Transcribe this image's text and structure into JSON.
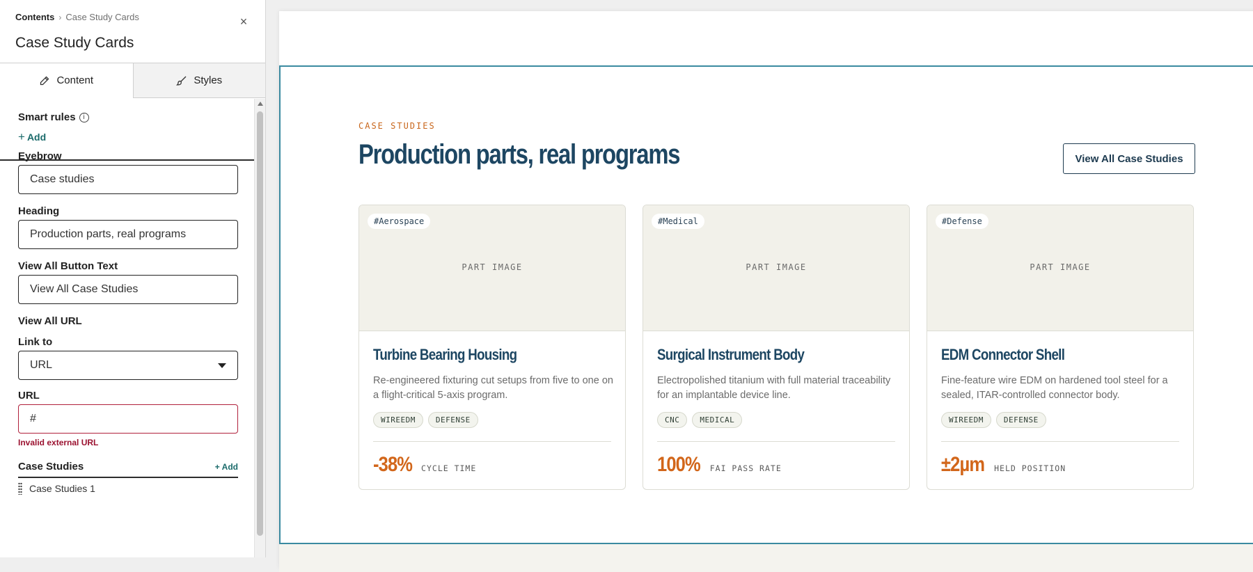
{
  "panel": {
    "breadcrumb_root": "Contents",
    "breadcrumb_sep": "›",
    "breadcrumb_current": "Case Study Cards",
    "title": "Case Study Cards",
    "close_icon": "×",
    "tabs": [
      {
        "label": "Content",
        "icon": "pencil-icon",
        "active": true
      },
      {
        "label": "Styles",
        "icon": "brush-icon",
        "active": false
      }
    ],
    "smart_rules_label": "Smart rules",
    "info_icon": "i",
    "add_plus": "+",
    "add_label": "Add",
    "fields": {
      "eyebrow_label": "Eyebrow",
      "eyebrow_value": "Case studies",
      "heading_label": "Heading",
      "heading_value": "Production parts, real programs",
      "button_text_label": "View All Button Text",
      "button_text_value": "View All Case Studies",
      "view_all_url_label": "View All URL",
      "link_to_label": "Link to",
      "link_to_value": "URL",
      "url_label": "URL",
      "url_value": "#",
      "url_error": "Invalid external URL"
    },
    "case_studies_label": "Case Studies",
    "case_studies_add": "+ Add",
    "case_studies_items": [
      "Case Studies 1"
    ]
  },
  "preview": {
    "eyebrow": "CASE STUDIES",
    "heading": "Production parts, real programs",
    "view_all_button": "View All Case Studies",
    "image_placeholder": "PART IMAGE",
    "cards": [
      {
        "tag": "#Aerospace",
        "title": "Turbine Bearing Housing",
        "description": "Re-engineered fixturing cut setups from five to one on a flight-critical 5-axis program.",
        "chips": [
          "WIREEDM",
          "DEFENSE"
        ],
        "stat_value": "-38%",
        "stat_label": "CYCLE TIME"
      },
      {
        "tag": "#Medical",
        "title": "Surgical Instrument Body",
        "description": "Electropolished titanium with full material traceability for an implantable device line.",
        "chips": [
          "CNC",
          "MEDICAL"
        ],
        "stat_value": "100%",
        "stat_label": "FAI PASS RATE"
      },
      {
        "tag": "#Defense",
        "title": "EDM Connector Shell",
        "description": "Fine-feature wire EDM on hardened tool steel for a sealed, ITAR-controlled connector body.",
        "chips": [
          "WIREEDM",
          "DEFENSE"
        ],
        "stat_value": "±2µm",
        "stat_label": "HELD POSITION"
      }
    ]
  },
  "colors": {
    "accent_orange": "#d2661a",
    "heading_blue": "#1d4662",
    "link_teal": "#1b6b6b",
    "error_red": "#9b1230",
    "module_outline": "#3a8aa0"
  }
}
